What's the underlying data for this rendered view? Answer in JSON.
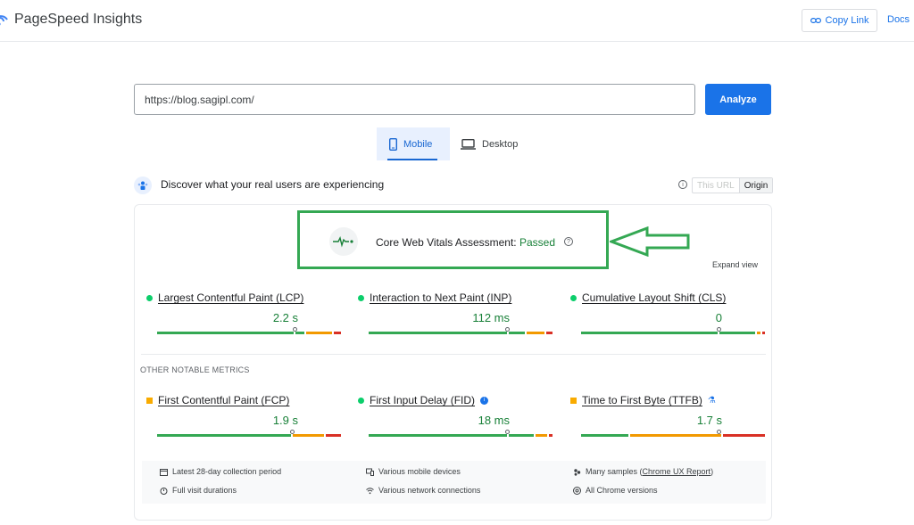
{
  "header": {
    "app_title": "PageSpeed Insights",
    "copy_link_label": "Copy Link",
    "docs_label": "Docs"
  },
  "search": {
    "url_value": "https://blog.sagipl.com/",
    "analyze_label": "Analyze"
  },
  "device_tabs": [
    {
      "label": "Mobile",
      "selected": true,
      "icon": "phone-icon"
    },
    {
      "label": "Desktop",
      "selected": false,
      "icon": "laptop-icon"
    }
  ],
  "field_data": {
    "heading": "Discover what your real users are experiencing",
    "toggle_url": "This URL",
    "toggle_origin": "Origin",
    "selected_scope": "Origin"
  },
  "assessment": {
    "label": "Core Web Vitals Assessment:",
    "status": "Passed",
    "expand_label": "Expand view"
  },
  "core_metrics": [
    {
      "name": "Largest Contentful Paint (LCP)",
      "value": "2.2 s",
      "status": "good",
      "good_fraction": 0.75
    },
    {
      "name": "Interaction to Next Paint (INP)",
      "value": "112 ms",
      "status": "good",
      "good_fraction": 0.75
    },
    {
      "name": "Cumulative Layout Shift (CLS)",
      "value": "0",
      "status": "good",
      "good_fraction": 0.75
    }
  ],
  "other_metrics_label": "OTHER NOTABLE METRICS",
  "other_metrics": [
    {
      "name": "First Contentful Paint (FCP)",
      "value": "1.9 s",
      "status": "needs-improvement"
    },
    {
      "name": "First Input Delay (FID)",
      "value": "18 ms",
      "status": "good"
    },
    {
      "name": "Time to First Byte (TTFB)",
      "value": "1.7 s",
      "status": "needs-improvement"
    }
  ],
  "facts": {
    "period": "Latest 28-day collection period",
    "devices": "Various mobile devices",
    "samples_prefix": "Many samples (",
    "samples_link": "Chrome UX Report",
    "samples_suffix": ")",
    "durations": "Full visit durations",
    "network": "Various network connections",
    "versions": "All Chrome versions"
  },
  "colors": {
    "good": "#0cce6b",
    "needs_improvement": "#f9ab00",
    "poor": "#d93025",
    "accent": "#1a73e8",
    "annotation": "#34a853"
  }
}
